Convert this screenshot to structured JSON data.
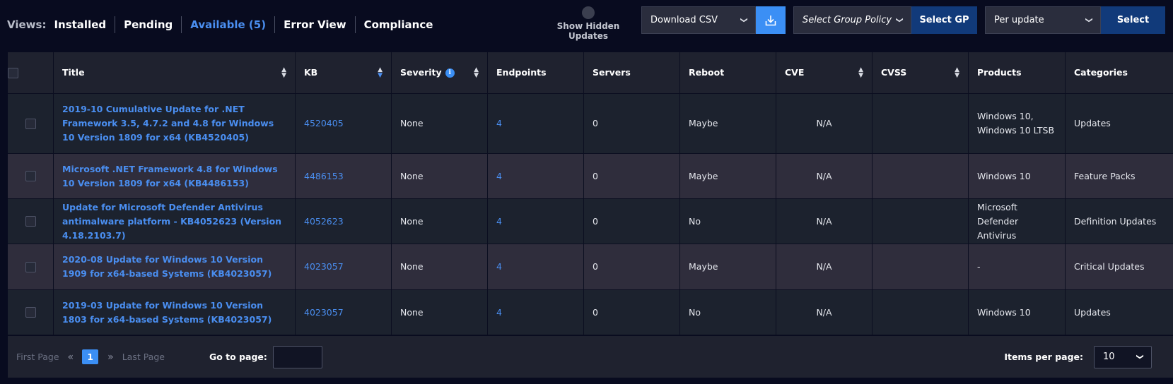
{
  "views": {
    "label": "Views:",
    "tabs": [
      {
        "label": "Installed",
        "active": false
      },
      {
        "label": "Pending",
        "active": false
      },
      {
        "label": "Available (5)",
        "active": true
      },
      {
        "label": "Error View",
        "active": false
      },
      {
        "label": "Compliance",
        "active": false
      }
    ]
  },
  "toolbar": {
    "show_hidden_label": "Show Hidden Updates",
    "download_select": "Download CSV",
    "group_policy_placeholder": "Select Group Policy",
    "select_gp_label": "Select GP",
    "per_update_select": "Per update",
    "select_label": "Select"
  },
  "table": {
    "columns": {
      "title": "Title",
      "kb": "KB",
      "severity": "Severity",
      "endpoints": "Endpoints",
      "servers": "Servers",
      "reboot": "Reboot",
      "cve": "CVE",
      "cvss": "CVSS",
      "products": "Products",
      "categories": "Categories"
    },
    "rows": [
      {
        "title": "2019-10 Cumulative Update for .NET Framework 3.5, 4.7.2 and 4.8 for Windows 10 Version 1809 for x64 (KB4520405)",
        "kb": "4520405",
        "severity": "None",
        "endpoints": "4",
        "servers": "0",
        "reboot": "Maybe",
        "cve": "N/A",
        "cvss": "",
        "products": "Windows 10, Windows 10 LTSB",
        "categories": "Updates"
      },
      {
        "title": "Microsoft .NET Framework 4.8 for Windows 10 Version 1809 for x64 (KB4486153)",
        "kb": "4486153",
        "severity": "None",
        "endpoints": "4",
        "servers": "0",
        "reboot": "Maybe",
        "cve": "N/A",
        "cvss": "",
        "products": "Windows 10",
        "categories": "Feature Packs"
      },
      {
        "title": "Update for Microsoft Defender Antivirus antimalware platform - KB4052623 (Version 4.18.2103.7)",
        "kb": "4052623",
        "severity": "None",
        "endpoints": "4",
        "servers": "0",
        "reboot": "No",
        "cve": "N/A",
        "cvss": "",
        "products": "Microsoft Defender Antivirus",
        "categories": "Definition Updates"
      },
      {
        "title": "2020-08 Update for Windows 10 Version 1909 for x64-based Systems (KB4023057)",
        "kb": "4023057",
        "severity": "None",
        "endpoints": "4",
        "servers": "0",
        "reboot": "Maybe",
        "cve": "N/A",
        "cvss": "",
        "products": "-",
        "categories": "Critical Updates"
      },
      {
        "title": "2019-03 Update for Windows 10 Version 1803 for x64-based Systems (KB4023057)",
        "kb": "4023057",
        "severity": "None",
        "endpoints": "4",
        "servers": "0",
        "reboot": "No",
        "cve": "N/A",
        "cvss": "",
        "products": "Windows 10",
        "categories": "Updates"
      }
    ]
  },
  "pager": {
    "first_label": "First Page",
    "last_label": "Last Page",
    "current_page": "1",
    "goto_label": "Go to page:",
    "goto_value": "",
    "items_label": "Items per page:",
    "items_value": "10"
  },
  "icons": {
    "download": "download-tray-icon",
    "info": "info-icon",
    "sort": "sort-arrows-icon",
    "chevron": "chevron-down-icon"
  },
  "colors": {
    "background": "#080b1f",
    "accent": "#3b8ff5",
    "link": "#4a8ef0",
    "button_dark_blue": "#113a7a"
  }
}
